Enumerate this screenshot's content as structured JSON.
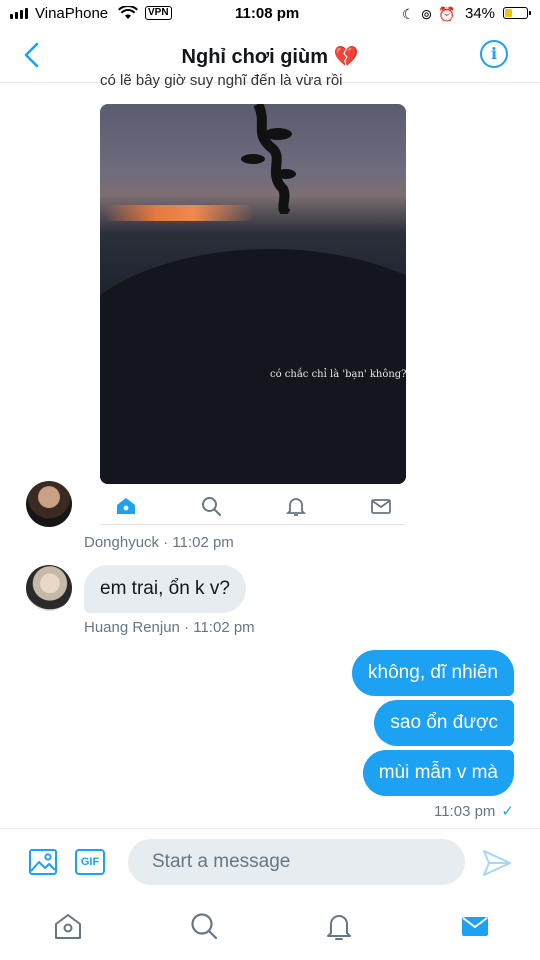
{
  "status_bar": {
    "carrier": "VinaPhone",
    "vpn": "VPN",
    "time": "11:08 pm",
    "battery": "34%",
    "battery_level": 0.34
  },
  "header": {
    "title": "Nghỉ chơi giùm 💔",
    "back_icon": "chevron-left-icon",
    "info_icon": "info-icon",
    "info_glyph": "i"
  },
  "shared_media": {
    "cutoff_text": "có lẽ bây giờ suy nghĩ đến là vừa rồi",
    "caption": "có chắc chỉ là 'bạn' không?"
  },
  "messages": [
    {
      "sender": "Donghyuck",
      "time": "11:02 pm",
      "meta": "Donghyuck · 11:02 pm"
    },
    {
      "sender": "Huang Renjun",
      "time": "11:02 pm",
      "text": "em trai, ổn k v?",
      "meta": "Huang Renjun · 11:02 pm"
    }
  ],
  "sent_messages": [
    "không, dĩ nhiên",
    "sao ổn được",
    "mùi mẫn v mà"
  ],
  "sent_meta": {
    "time": "11:03 pm",
    "check": "✓"
  },
  "composer": {
    "gif_label": "GIF",
    "placeholder": "Start a message"
  },
  "colors": {
    "accent": "#1da1f2",
    "bubble_received": "#e6ecf0",
    "meta": "#657786"
  },
  "tabs": [
    "home-icon",
    "search-icon",
    "notifications-icon",
    "messages-icon"
  ]
}
